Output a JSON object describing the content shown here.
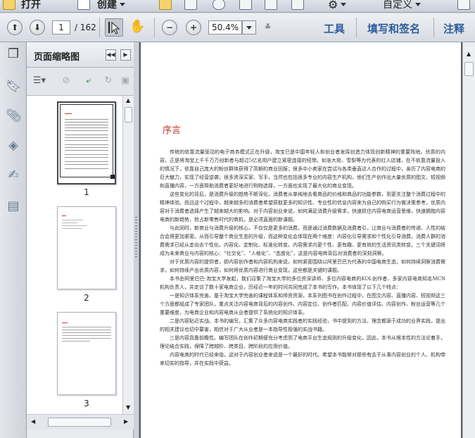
{
  "menubar": {
    "open_label": "打开",
    "create_label": "创建",
    "customize_label": "自定义"
  },
  "toolbar": {
    "current_page": "1",
    "total_pages": "/ 162",
    "zoom": "50.4%",
    "tools_label": "工具",
    "sign_label": "填写和签名",
    "comment_label": "注释"
  },
  "thumbnail_panel": {
    "title": "页面缩略图",
    "thumbnails": [
      {
        "label": "1",
        "selected": true
      },
      {
        "label": "2",
        "selected": false
      },
      {
        "label": "3",
        "selected": false
      }
    ]
  },
  "document": {
    "heading": "序言",
    "paragraphs": [
      "传统的依靠流量驱动的电子商务模式正在升级，淘宝已是中国年轻人和创业者发挥创造力体现创新精神的重要阵地。优质的内容，正是将淘宝上千千万万创新者与超过5亿名用户建立紧密连接的纽带。如张大奕、雪梨等为代表的红人店铺，在不依靠流量投入的情况下，依靠自己庞大的粉丝群体获得了高额的商业回报；很多中小卖家在尝试与各类垂直达人合作的过程中，亲历了内容电商的巨大魅力，实现了经营逆袭；很多资深买家、写手，当然也包括很多专业的内容生产机构，他们生产创作出大量优质的图文、短视频和直播内容，一方面帮助消费者更好地进行购物选择，一方面也实现了最大化的商业变现。",
      "这些变化的背后，是消费升级的趋势不断深化，消费者从单纯地去看商品的价格和商品的功能参数，到更关注整个消费过程中的精神体验。而且这个过程中，越来越多的消费者希望获取更多的知识性、专业性的信息内容来为自己的购买行为做决策参考，优质内容对于消费者选择产生了越来越大的影响。对于内容创业来说，如何满足消费升级需求，快速抓住内容电商运营思维，快速拥抱内容电商的新趋势，抢占新零售时代的商机，是必须直面的新课题。",
      "与此同时，新商业与消费升级的核心，不仅仅是更多的消费，而是通过消费数据及消费者引，让商业与消费者的传递、人性的结合会得更加紧密。从而引导整个商业生态的升级，而这种变化会体现在两个维度：内容化引导需求和个性化引导消费。消费人群的消费需求已经从走向去个性化、内容化、定制化、标准化转变。内容需求内更个性、更有趣、更有效的生活资讯类转变。三个关键词将成为未来商业与内容的核心：“社交化”、“人格化”、“态度化”，这是内容电商背后对消费者的深刻洞察。",
      "对于优质内容的提供者，即内容创作者和内容机构来说，如何紧密围绕以阿里巴巴为代表的中国电商生态，如何持续洞察消费需求，如何持续产出优质内容，如何将优质内容进行商业变现，这些都是关键的课题。",
      "本书由阿里巴巴·淘宝大学发起，我们召集了淘宝大学的多位资深讲师、多位内容电商的KOL创作者、多家内容电商知名MCN机构负责人，并走访了数十家电商企业，历经近一年的时间共同完成了本书的写作。本书体现了以下几个特点：",
      "一是知识体系完善。基于淘宝大学完善的课程体系和师资资源，本系列图书在创作过程中，在图文内容、直播内容、短视频这三个方面都组成了专家团队，重点关注内容电商背后的内容创作、内容定位、创作者匹配、内容价值评估、内容创作、粉丝运营等几个重要维度，为电商企业和内容电商从业者提供了系统化的知识体系。",
      "二是内容贴近实战。本书的编写，汇集了众多内容电商实践者的实践经验，书中提到的方法、理念都源于成功的业界实践，提出的相关建议也切中要害，相信对于广大从业者是一本指导性极强的实战书籍。",
      "三是内容具备前瞻性。编写团队在创作初期便充分考虑到了电商平台生态规则的升级变化，因此，本书从根本性的方法论着手，理论结合实践，保障了跨越阶、跨类目、跨阶段的应用价值。",
      "内容电商的时代已经来临，这对于内容创业者来说是一个最好的时代。希望本书能够对那些有志于从事内容创业的个人、机构带来切实的指导，并在实践中获益。"
    ]
  }
}
